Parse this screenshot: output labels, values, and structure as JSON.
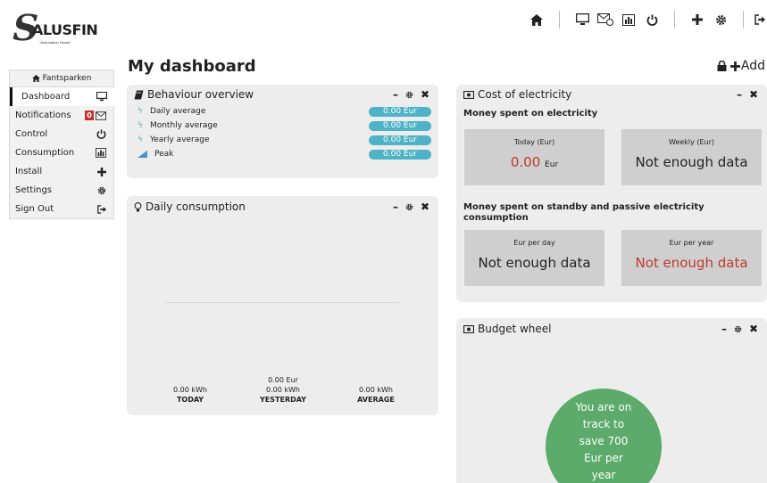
{
  "brand": {
    "letter": "S",
    "name": "ALUSFIN",
    "tagline": "\"Automation House\""
  },
  "sidebar": {
    "header": "Fantsparken",
    "items": [
      {
        "label": "Dashboard",
        "icon": "monitor-icon"
      },
      {
        "label": "Notifications",
        "badge": "0",
        "icon": "envelope-icon"
      },
      {
        "label": "Control",
        "icon": "power-icon"
      },
      {
        "label": "Consumption",
        "icon": "bar-chart-icon"
      },
      {
        "label": "Install",
        "icon": "plus-icon"
      },
      {
        "label": "Settings",
        "icon": "gear-icon"
      },
      {
        "label": "Sign Out",
        "icon": "sign-out-icon"
      }
    ]
  },
  "page": {
    "title": "My dashboard",
    "add_label": "Add"
  },
  "behaviour": {
    "title": "Behaviour overview",
    "rows": [
      {
        "label": "Daily average",
        "value": "0.00 Eur"
      },
      {
        "label": "Monthly average",
        "value": "0.00 Eur"
      },
      {
        "label": "Yearly average",
        "value": "0.00 Eur"
      },
      {
        "label": "Peak",
        "value": "0.00 Eur"
      }
    ]
  },
  "daily": {
    "title": "Daily consumption",
    "today": {
      "kwh": "0.00 kWh",
      "label": "TODAY"
    },
    "yesterday": {
      "eur": "0.00 Eur",
      "kwh": "0.00 kWh",
      "label": "YESTERDAY"
    },
    "average": {
      "kwh": "0.00 kWh",
      "label": "AVERAGE"
    }
  },
  "cost": {
    "title": "Cost of electricity",
    "spent_heading": "Money spent on electricity",
    "today_label": "Today (Eur)",
    "today_value": "0.00",
    "today_unit": "Eur",
    "weekly_label": "Weekly (Eur)",
    "weekly_value": "Not enough data",
    "standby_heading": "Money spent on standby and passive electricity consumption",
    "per_day_label": "Eur per day",
    "per_day_value": "Not enough data",
    "per_year_label": "Eur per year",
    "per_year_value": "Not enough data"
  },
  "budget": {
    "title": "Budget wheel",
    "message_lines": [
      "You are on",
      "track to",
      "save 700",
      "Eur per",
      "year"
    ]
  },
  "colors": {
    "pill": "#4eb3c6",
    "wheel": "#5cab6a",
    "badge": "#c9302c",
    "alert_text": "#c0392b"
  }
}
